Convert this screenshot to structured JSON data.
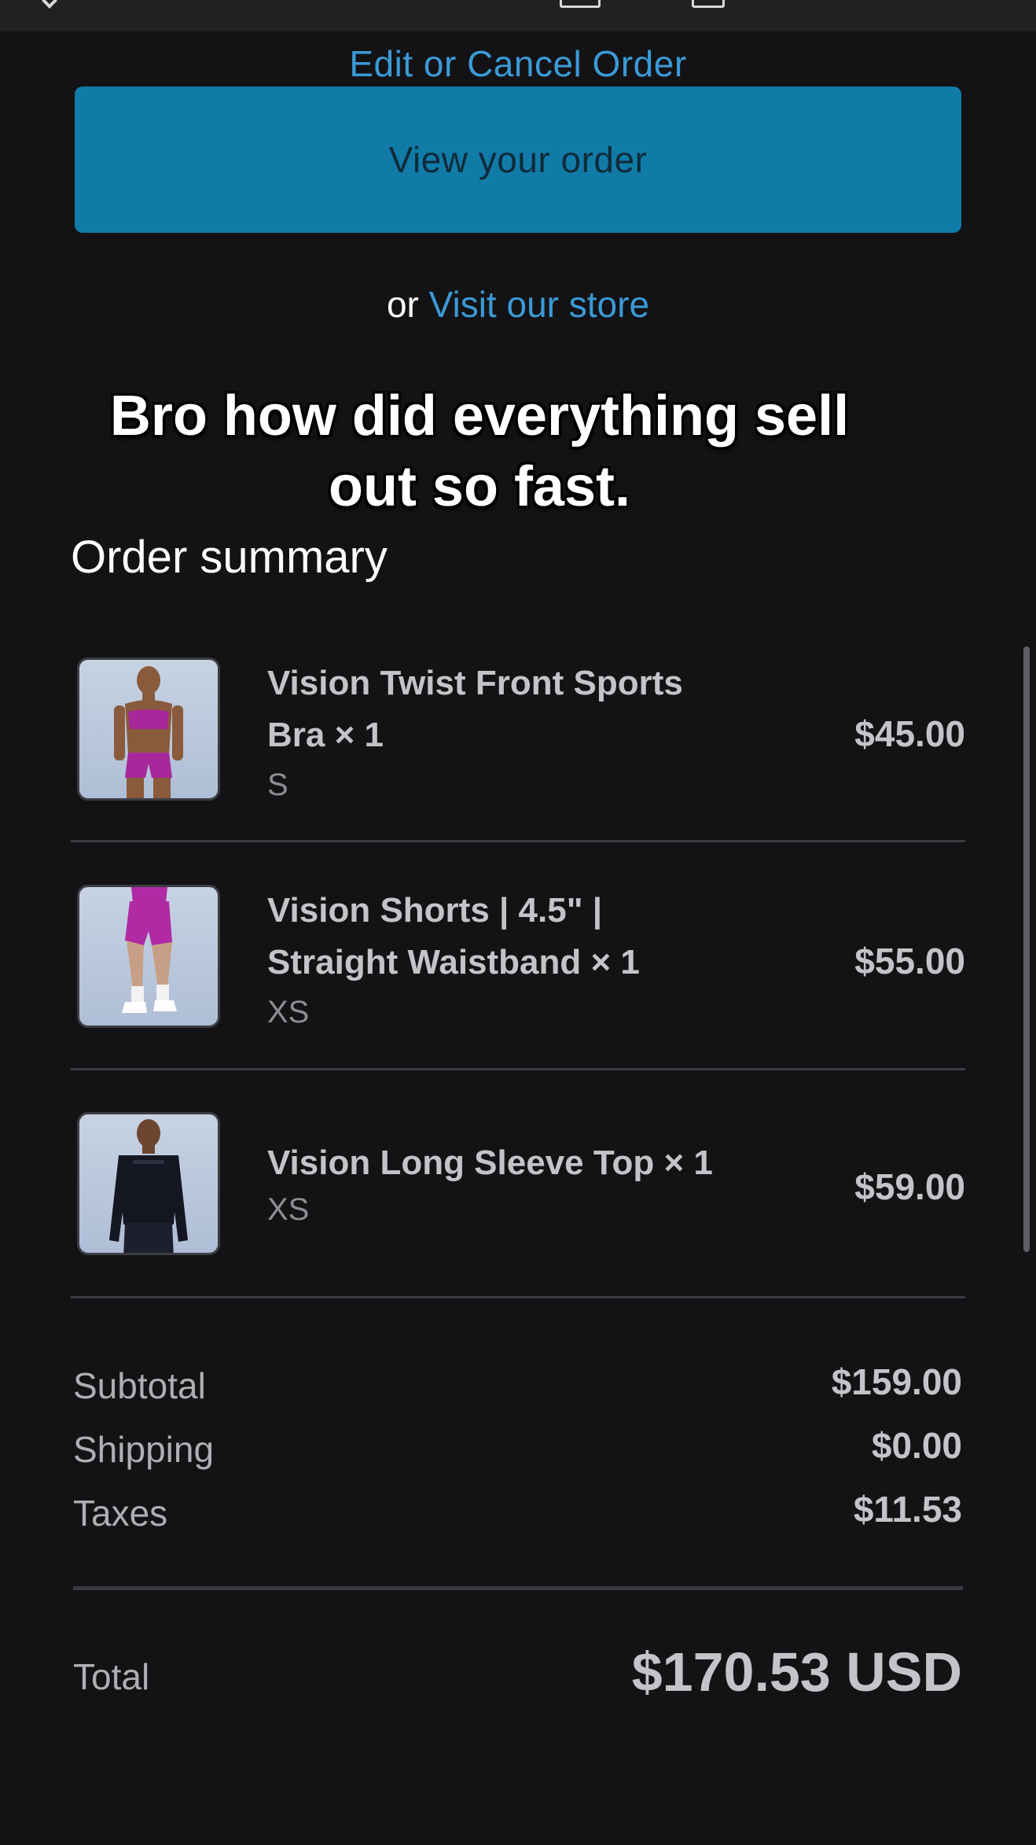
{
  "header": {
    "edit_link": "Edit or Cancel Order",
    "view_button": "View your order",
    "or_text": "or",
    "store_link": "Visit our store"
  },
  "overlay_caption": "Bro how did everything sell out so fast.",
  "summary": {
    "title": "Order summary",
    "items": [
      {
        "name_line1": "Vision Twist Front Sports",
        "name_line2": "Bra × 1",
        "variant": "S",
        "price": "$45.00",
        "thumb_color": "#a8279a"
      },
      {
        "name_line1": "Vision Shorts | 4.5\" |",
        "name_line2": "Straight Waistband × 1",
        "variant": "XS",
        "price": "$55.00",
        "thumb_color": "#b02aa4"
      },
      {
        "name_line1": "Vision Long Sleeve Top × 1",
        "variant": "XS",
        "price": "$59.00",
        "thumb_color": "#141722"
      }
    ]
  },
  "totals": {
    "subtotal_label": "Subtotal",
    "subtotal_value": "$159.00",
    "shipping_label": "Shipping",
    "shipping_value": "$0.00",
    "taxes_label": "Taxes",
    "taxes_value": "$11.53",
    "total_label": "Total",
    "total_value": "$170.53 USD"
  },
  "colors": {
    "background": "#131315",
    "accent_link": "#3b9ad6",
    "button": "#117ba8"
  }
}
